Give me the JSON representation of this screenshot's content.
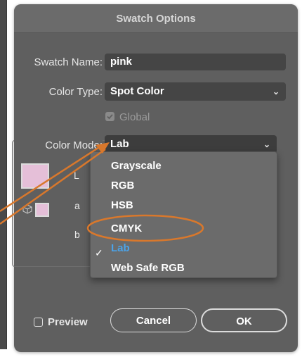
{
  "dialog": {
    "title": "Swatch Options",
    "swatch_name_label": "Swatch Name:",
    "swatch_name_value": "pink",
    "color_type_label": "Color Type:",
    "color_type_value": "Spot Color",
    "global_label": "Global",
    "global_checked": true,
    "color_mode_label": "Color Mode:",
    "color_mode_value": "Lab",
    "sliders": [
      {
        "label": "L",
        "color": "#3a2a3a"
      },
      {
        "label": "a",
        "color": "#1aa6e0"
      },
      {
        "label": "b",
        "color": "#1aa6e0"
      }
    ],
    "preview_label": "Preview",
    "preview_checked": false,
    "cancel_label": "Cancel",
    "ok_label": "OK",
    "swatch_color": "#e5bfd8"
  },
  "color_mode_menu": {
    "items": [
      "Grayscale",
      "RGB",
      "HSB",
      "CMYK",
      "Lab",
      "Web Safe RGB"
    ],
    "selected": "Lab"
  },
  "annotation_color": "#d9782c",
  "colors": {
    "dialog_bg": "#5f5f5f",
    "field_bg": "#454545",
    "selected_item": "#4ba3e8"
  }
}
